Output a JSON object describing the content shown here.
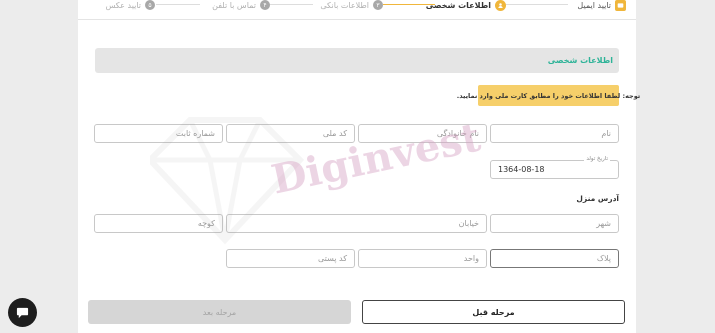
{
  "steps": [
    {
      "num": "",
      "label": "تایید ایمیل",
      "state": "done",
      "icon": "message-icon"
    },
    {
      "num": "",
      "label": "اطلاعات شخصی",
      "state": "active",
      "icon": "user-icon"
    },
    {
      "num": "۳",
      "label": "اطلاعات بانکی",
      "state": "pending"
    },
    {
      "num": "۴",
      "label": "تماس با تلفن",
      "state": "pending"
    },
    {
      "num": "۵",
      "label": "تایید عکس",
      "state": "pending"
    }
  ],
  "section": {
    "title": "اطلاعات شخصی"
  },
  "notice": "توجه: لطفا اطلاعات خود را مطابق کارت ملی وارد نمایید.",
  "fields": {
    "first_name": {
      "placeholder": "نام"
    },
    "last_name": {
      "placeholder": "نام خانوادگی"
    },
    "national_code": {
      "placeholder": "کد ملی"
    },
    "phone": {
      "placeholder": "شماره ثابت"
    },
    "birth_date": {
      "label": "تاریخ تولد",
      "value": "1364-08-18"
    },
    "city": {
      "placeholder": "شهر"
    },
    "street": {
      "placeholder": "خیابان"
    },
    "alley": {
      "placeholder": "کوچه"
    },
    "plaque": {
      "placeholder": "پلاک"
    },
    "unit": {
      "placeholder": "واحد"
    },
    "postal_code": {
      "placeholder": "کد پستی"
    }
  },
  "address_title": "آدرس منزل",
  "buttons": {
    "prev": "مرحله قبل",
    "next": "مرحله بعد"
  },
  "watermark": "Diginvest",
  "colors": {
    "accent": "#2eb398",
    "warning": "#f6cf6a",
    "step_active": "#f0b63b"
  }
}
